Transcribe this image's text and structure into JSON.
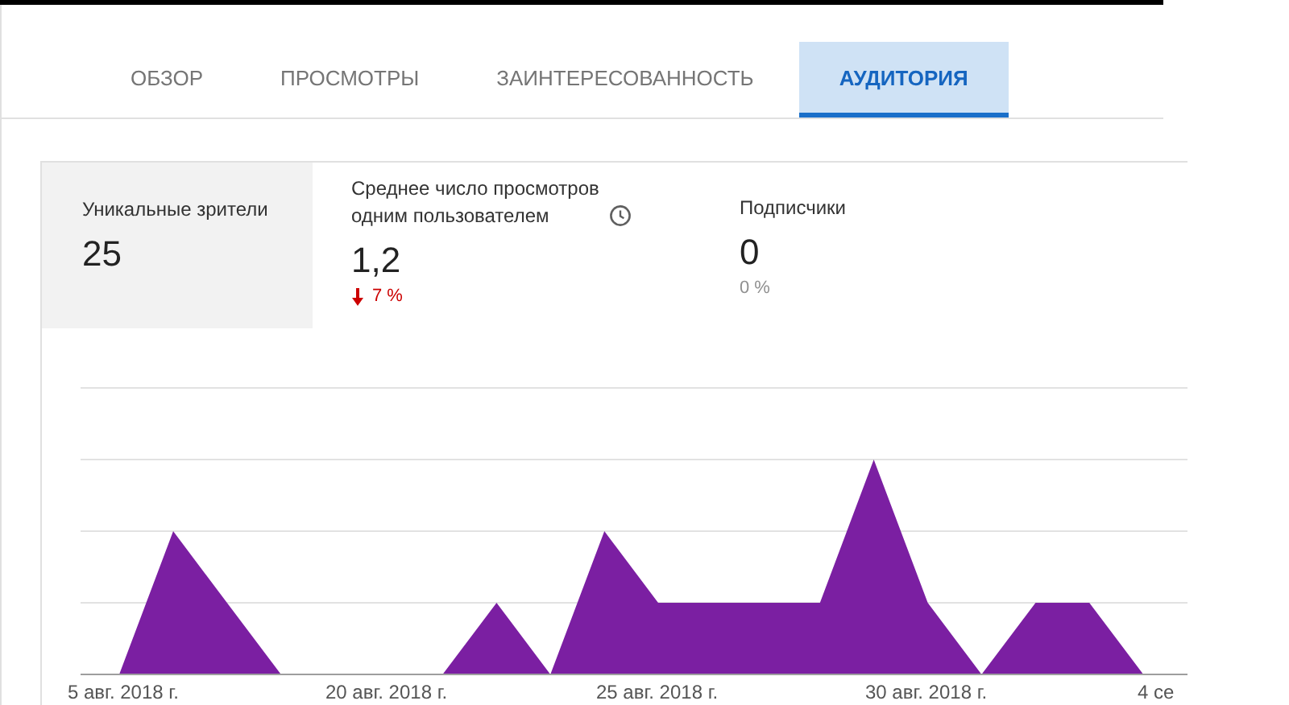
{
  "tabs": [
    {
      "label": "ОБЗОР",
      "selected": false
    },
    {
      "label": "ПРОСМОТРЫ",
      "selected": false
    },
    {
      "label": "ЗАИНТЕРЕСОВАННОСТЬ",
      "selected": false
    },
    {
      "label": "АУДИТОРИЯ",
      "selected": true
    }
  ],
  "metrics": [
    {
      "title": "Уникальные зрители",
      "value": "25",
      "selected": true,
      "info_icon": false
    },
    {
      "title": "Среднее число просмотров одним пользователем",
      "value": "1,2",
      "selected": false,
      "info_icon": true,
      "change": "7 %",
      "down": true
    },
    {
      "title": "Подписчики",
      "value": "0",
      "selected": false,
      "info_icon": false,
      "change": "0 %",
      "down": false
    }
  ],
  "chart": {
    "x_labels": [
      "5 авг. 2018 г.",
      "20 авг. 2018 г.",
      "25 авг. 2018 г.",
      "30 авг. 2018 г.",
      "4 се"
    ]
  }
}
